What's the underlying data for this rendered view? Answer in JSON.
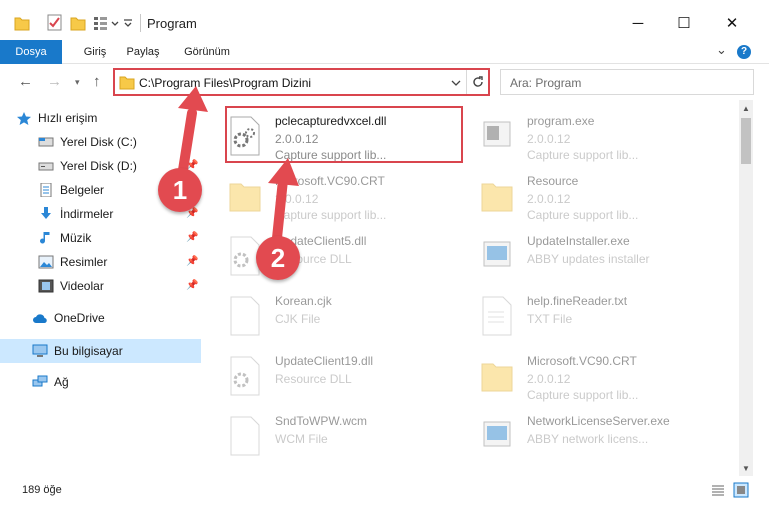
{
  "window": {
    "title": "Program",
    "minimize_glyph": "─",
    "maximize_glyph": "☐",
    "close_glyph": "✕"
  },
  "ribbon": {
    "tabs": [
      "Dosya",
      "Giriş",
      "Paylaş",
      "Görünüm"
    ],
    "expand_glyph": "⌄",
    "help_glyph": "?"
  },
  "address": {
    "path": "C:\\Program Files\\Program Dizini",
    "search_placeholder": "Ara: Program"
  },
  "sidebar": {
    "quick_access": "Hızlı erişim",
    "items": [
      {
        "label": "Yerel Disk (C:)",
        "icon": "drive-icon"
      },
      {
        "label": "Yerel Disk (D:)",
        "icon": "drive-icon"
      },
      {
        "label": "Belgeler",
        "icon": "document-icon"
      },
      {
        "label": "İndirmeler",
        "icon": "download-icon"
      },
      {
        "label": "Müzik",
        "icon": "music-icon"
      },
      {
        "label": "Resimler",
        "icon": "picture-icon"
      },
      {
        "label": "Videolar",
        "icon": "video-icon"
      }
    ],
    "onedrive": "OneDrive",
    "this_pc": "Bu bilgisayar",
    "network": "Ağ"
  },
  "files": [
    {
      "name": "pclecapturedvxcel.dll",
      "line1": "2.0.0.12",
      "line2": "Capture support lib..."
    },
    {
      "name": "program.exe",
      "line1": "2.0.0.12",
      "line2": "Capture support lib..."
    },
    {
      "name": "Microsoft.VC90.CRT",
      "line1": "2.0.0.12",
      "line2": "Capture support lib..."
    },
    {
      "name": "Resource",
      "line1": "2.0.0.12",
      "line2": "Capture support lib..."
    },
    {
      "name": "UpdateClient5.dll",
      "line1": "Resource DLL",
      "line2": ""
    },
    {
      "name": "UpdateInstaller.exe",
      "line1": "ABBY updates installer",
      "line2": ""
    },
    {
      "name": "Korean.cjk",
      "line1": "CJK File",
      "line2": ""
    },
    {
      "name": "help.fineReader.txt",
      "line1": "TXT File",
      "line2": ""
    },
    {
      "name": "UpdateClient19.dll",
      "line1": "Resource DLL",
      "line2": ""
    },
    {
      "name": "Microsoft.VC90.CRT",
      "line1": "2.0.0.12",
      "line2": "Capture support lib..."
    },
    {
      "name": "SndToWPW.wcm",
      "line1": "WCM File",
      "line2": ""
    },
    {
      "name": "NetworkLicenseServer.exe",
      "line1": "ABBY network licens...",
      "line2": ""
    }
  ],
  "status": {
    "item_count": "189 öğe"
  },
  "annotations": {
    "badge1": "1",
    "badge2": "2",
    "color": "#e24a50"
  }
}
